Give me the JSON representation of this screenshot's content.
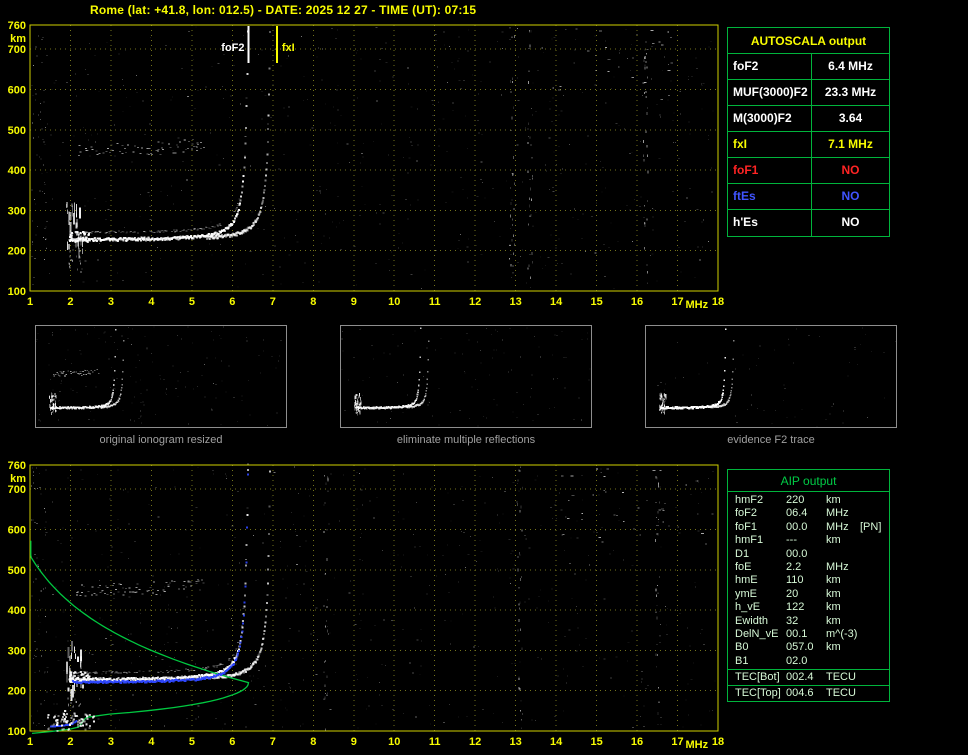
{
  "header": {
    "title": "Rome (lat: +41.8, lon: 012.5) - DATE: 2025 12 27 - TIME (UT): 07:15"
  },
  "colors": {
    "yellow": "#f8fc00",
    "plot_border": "#cfcf00",
    "grid": "#74741c",
    "table_green": "#00b43c",
    "red": "#ff2424",
    "blue": "#4054ff",
    "white": "#ffffff",
    "profile_green": "#00c840",
    "trace_blue": "#2e46ff",
    "caption_gray": "#a0a0a0"
  },
  "axes": {
    "y_ticks": [
      "760",
      "700",
      "600",
      "500",
      "400",
      "300",
      "200",
      "100"
    ],
    "y_unit": "km",
    "x_ticks": [
      "1",
      "2",
      "3",
      "4",
      "5",
      "6",
      "7",
      "8",
      "9",
      "10",
      "11",
      "12",
      "13",
      "14",
      "15",
      "16",
      "17",
      "18"
    ],
    "x_unit": "MHz",
    "x_range": [
      1,
      18
    ],
    "y_range": [
      100,
      760
    ]
  },
  "top_plot": {
    "markers": [
      {
        "label": "foF2",
        "freq": 6.4,
        "color": "#ffffff"
      },
      {
        "label": "fxI",
        "freq": 7.1,
        "color": "#f8fc00"
      }
    ]
  },
  "autoscala_table": {
    "title": "AUTOSCALA output",
    "rows": [
      {
        "label": "foF2",
        "value": "6.4 MHz",
        "color": "#ffffff"
      },
      {
        "label": "MUF(3000)F2",
        "value": "23.3 MHz",
        "color": "#ffffff"
      },
      {
        "label": "M(3000)F2",
        "value": "3.64",
        "color": "#ffffff"
      },
      {
        "label": "fxI",
        "value": "7.1 MHz",
        "color": "#f8fc00"
      },
      {
        "label": "foF1",
        "value": "NO",
        "color": "#ff2424"
      },
      {
        "label": "ftEs",
        "value": "NO",
        "color": "#4054ff"
      },
      {
        "label": "h'Es",
        "value": "NO",
        "color": "#ffffff"
      }
    ]
  },
  "thumbnails": [
    {
      "caption": "original ionogram resized"
    },
    {
      "caption": "eliminate multiple reflections"
    },
    {
      "caption": "evidence F2 trace"
    }
  ],
  "aip_table": {
    "title": "AIP output",
    "rows": [
      {
        "label": "hmF2",
        "value": "220",
        "unit": "km",
        "extra": ""
      },
      {
        "label": "foF2",
        "value": "06.4",
        "unit": "MHz",
        "extra": ""
      },
      {
        "label": "foF1",
        "value": "00.0",
        "unit": "MHz",
        "extra": "[PN]"
      },
      {
        "label": "hmF1",
        "value": "---",
        "unit": "km",
        "extra": ""
      },
      {
        "label": "D1",
        "value": "00.0",
        "unit": "",
        "extra": ""
      },
      {
        "label": "foE",
        "value": "2.2",
        "unit": "MHz",
        "extra": ""
      },
      {
        "label": "hmE",
        "value": "110",
        "unit": "km",
        "extra": ""
      },
      {
        "label": "ymE",
        "value": "20",
        "unit": "km",
        "extra": ""
      },
      {
        "label": "h_vE",
        "value": "122",
        "unit": "km",
        "extra": ""
      },
      {
        "label": "Ewidth",
        "value": "32",
        "unit": "km",
        "extra": ""
      },
      {
        "label": "DelN_vE",
        "value": "00.1",
        "unit": "m^(-3)",
        "extra": ""
      },
      {
        "label": "B0",
        "value": "057.0",
        "unit": "km",
        "extra": ""
      },
      {
        "label": "B1",
        "value": "02.0",
        "unit": "",
        "extra": ""
      }
    ],
    "tec_rows": [
      {
        "label": "TEC[Bot]",
        "value": "002.4",
        "unit": "TECU"
      },
      {
        "label": "TEC[Top]",
        "value": "004.6",
        "unit": "TECU"
      }
    ]
  },
  "profile": {
    "hmF2": 220,
    "foF2": 6.4,
    "foE": 2.2,
    "hmE": 110
  }
}
